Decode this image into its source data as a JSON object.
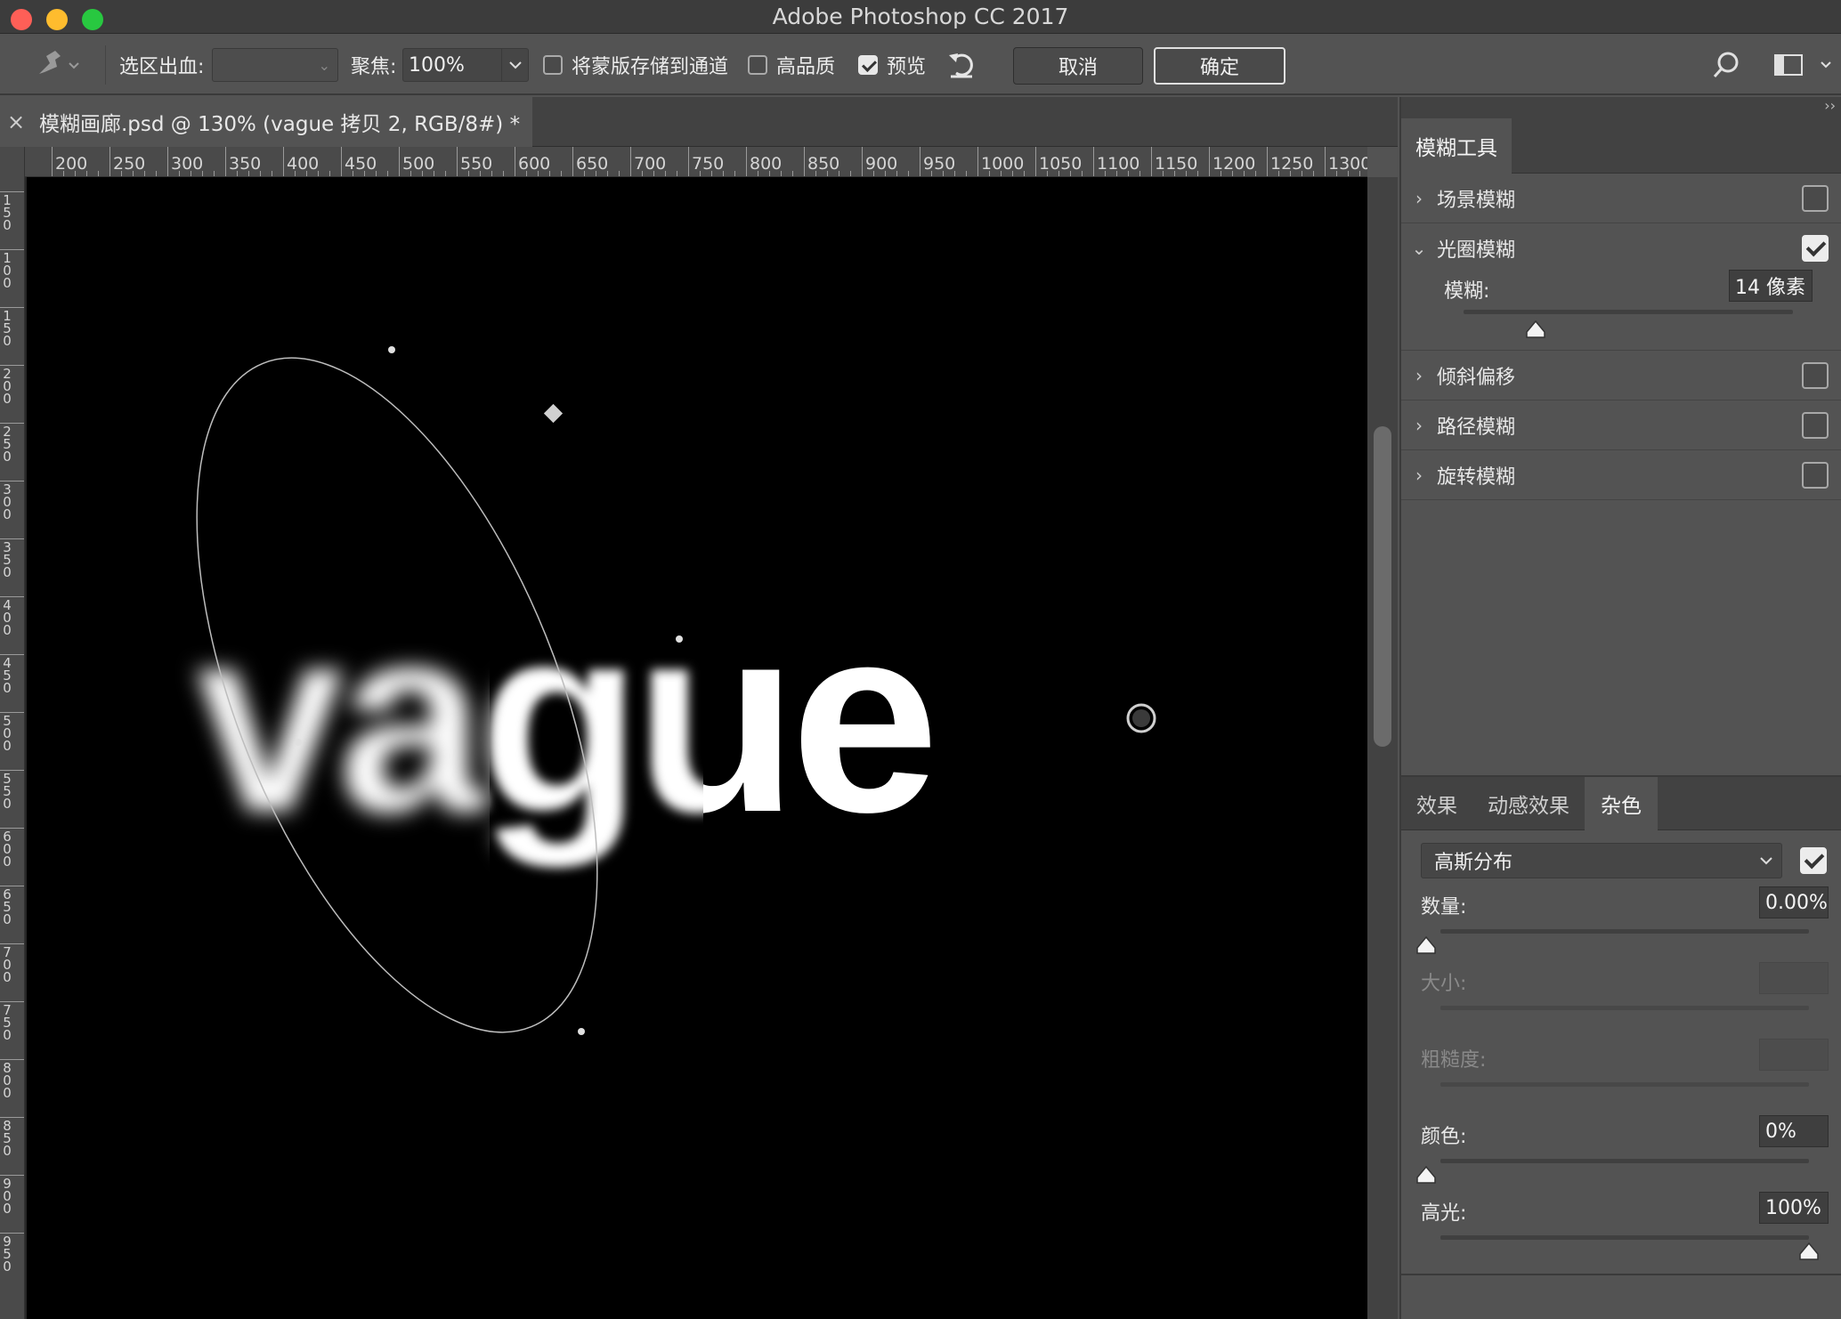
{
  "app": {
    "title": "Adobe Photoshop CC 2017"
  },
  "options_bar": {
    "selection_bleed_label": "选区出血:",
    "selection_bleed_value": "",
    "focus_label": "聚焦:",
    "focus_value": "100%",
    "save_mask_label": "将蒙版存储到通道",
    "save_mask_checked": false,
    "high_quality_label": "高品质",
    "high_quality_checked": false,
    "preview_label": "预览",
    "preview_checked": true,
    "cancel_label": "取消",
    "ok_label": "确定"
  },
  "document": {
    "tab_title": "模糊画廊.psd @ 130% (vague 拷贝 2, RGB/8#) *",
    "close_glyph": "×",
    "canvas_text": "vague"
  },
  "ruler": {
    "h_labels": [
      "200",
      "250",
      "300",
      "350",
      "400",
      "450",
      "500",
      "550",
      "600",
      "650",
      "700",
      "750",
      "800",
      "850",
      "900",
      "950",
      "1000",
      "1050",
      "1100",
      "1150",
      "1200",
      "1250",
      "1300"
    ],
    "v_labels": [
      "150",
      "100",
      "150",
      "200",
      "250",
      "300",
      "350",
      "400",
      "450",
      "500",
      "550",
      "600",
      "650",
      "700",
      "750",
      "800",
      "850",
      "900",
      "950"
    ]
  },
  "blur_tools": {
    "panel_title": "模糊工具",
    "items": [
      {
        "label": "场景模糊",
        "checked": false,
        "expanded": false
      },
      {
        "label": "光圈模糊",
        "checked": true,
        "expanded": true
      },
      {
        "label": "倾斜偏移",
        "checked": false,
        "expanded": false
      },
      {
        "label": "路径模糊",
        "checked": false,
        "expanded": false
      },
      {
        "label": "旋转模糊",
        "checked": false,
        "expanded": false
      }
    ],
    "iris_blur": {
      "label": "模糊:",
      "value": "14 像素",
      "slider_fraction": 0.22
    }
  },
  "effects_panel": {
    "tabs": [
      "效果",
      "动感效果",
      "杂色"
    ],
    "active_tab": "杂色",
    "distribution": "高斯分布",
    "noise_enabled": true,
    "amount_label": "数量:",
    "amount_value": "0.00%",
    "amount_fraction": 0.0,
    "size_label": "大小:",
    "size_value": "",
    "roughness_label": "粗糙度:",
    "roughness_value": "",
    "color_label": "颜色:",
    "color_value": "0%",
    "color_fraction": 0.0,
    "highlight_label": "高光:",
    "highlight_value": "100%",
    "highlight_fraction": 1.0
  },
  "colors": {
    "traffic_close": "#fe5f57",
    "traffic_min": "#febc2e",
    "traffic_max": "#28c840",
    "panel_bg": "#535353",
    "canvas_bg": "#000000"
  }
}
